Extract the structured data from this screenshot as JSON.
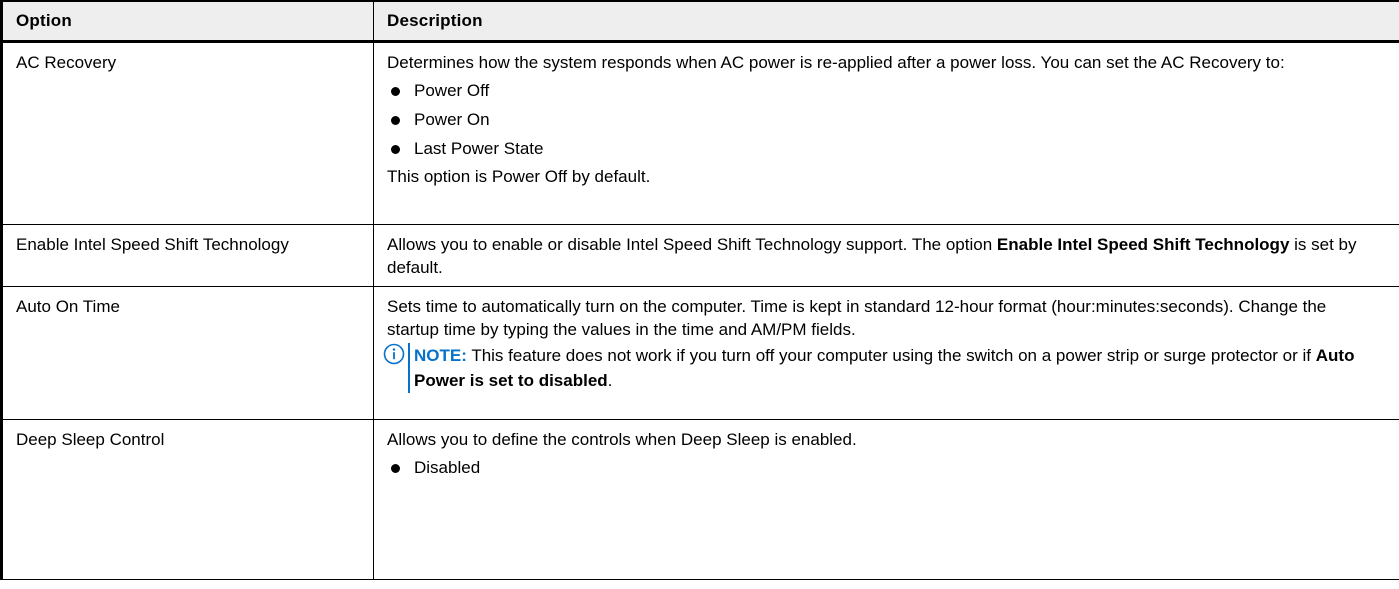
{
  "header": {
    "option": "Option",
    "description": "Description"
  },
  "rows": [
    {
      "option": "AC Recovery",
      "text": "Determines how the system responds when AC power is re-applied after a power loss. You can set the AC Recovery to:",
      "bullets": [
        "Power Off",
        "Power On",
        "Last Power State"
      ],
      "footer": "This option is Power Off by default."
    },
    {
      "option": "Enable Intel Speed Shift Technology",
      "text_before": "Allows you to enable or disable Intel Speed Shift Technology support. The option",
      "bold": "Enable Intel Speed Shift Technology",
      "text_after": "is set by default."
    },
    {
      "option": "Auto On Time",
      "text": "Sets time to automatically turn on the computer. Time is kept in standard 12-hour format (hour:minutes:seconds). Change the startup time by typing the values in the time and AM/PM fields.",
      "note": {
        "label": "NOTE:",
        "text_before": "This feature does not work if you turn off your computer using the switch on a power strip or surge protector or if",
        "bold": "Auto Power is set to disabled",
        "text_after": ".",
        "icon": "info-icon",
        "color": "#0672cb"
      }
    },
    {
      "option": "Deep Sleep Control",
      "text": "Allows you to define the controls when Deep Sleep is enabled.",
      "bullets": [
        "Disabled"
      ]
    }
  ]
}
